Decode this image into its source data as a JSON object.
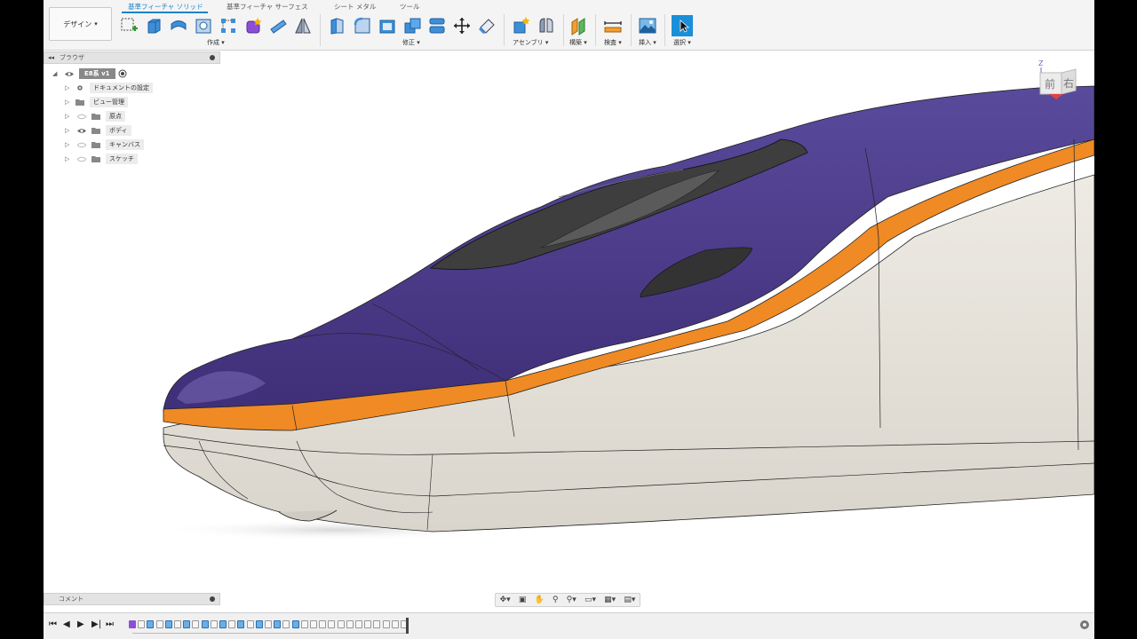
{
  "workspace": {
    "label": "デザイン",
    "caret": "▾"
  },
  "tabs": [
    {
      "label": "基準フィーチャ ソリッド",
      "active": true
    },
    {
      "label": "基準フィーチャ サーフェス",
      "active": false
    },
    {
      "label": "シート メタル",
      "active": false
    },
    {
      "label": "ツール",
      "active": false
    }
  ],
  "toolbar_groups": [
    {
      "label": "作成 ▾",
      "icons": [
        "new-sketch-icon",
        "extrude-icon",
        "revolve-icon",
        "hole-icon",
        "rectangular-pattern-icon",
        "create-form-icon",
        "pipe-icon",
        "mirror-icon"
      ]
    },
    {
      "label": "修正 ▾",
      "icons": [
        "press-pull-icon",
        "fillet-icon",
        "shell-icon",
        "combine-icon",
        "split-body-icon",
        "move-icon",
        "appearance-icon"
      ]
    },
    {
      "label": "アセンブリ ▾",
      "icons": [
        "new-component-icon",
        "joint-icon"
      ]
    },
    {
      "label": "構築 ▾",
      "icons": [
        "offset-plane-icon"
      ]
    },
    {
      "label": "検査 ▾",
      "icons": [
        "measure-icon"
      ]
    },
    {
      "label": "挿入 ▾",
      "icons": [
        "insert-image-icon"
      ]
    },
    {
      "label": "選択 ▾",
      "icons": [
        "select-cursor-icon"
      ]
    }
  ],
  "browser": {
    "title": "ブラウザ",
    "arrows": "◂◂",
    "root": {
      "label": "E8系 v1"
    },
    "items": [
      {
        "label": "ドキュメントの設定",
        "icon": "gear-icon",
        "visible": null
      },
      {
        "label": "ビュー管理",
        "icon": "folder-icon",
        "visible": null
      },
      {
        "label": "原点",
        "icon": "folder-icon",
        "visible": false
      },
      {
        "label": "ボディ",
        "icon": "folder-icon",
        "visible": true
      },
      {
        "label": "キャンバス",
        "icon": "folder-icon",
        "visible": false
      },
      {
        "label": "スケッチ",
        "icon": "folder-icon",
        "visible": false
      }
    ]
  },
  "comments": {
    "title": "コメント"
  },
  "viewcube": {
    "front": "前",
    "right": "右",
    "axis": "Z"
  },
  "colors": {
    "accent": "#1a83c9",
    "body_purple": "#4a3a86",
    "stripe_orange": "#f08a24",
    "body_white": "#e6e2da",
    "window_dark": "#3a3a3a"
  },
  "navbar": {
    "icons": [
      "orbit-icon",
      "look-at-icon",
      "pan-icon",
      "zoom-icon",
      "fit-icon",
      "display-settings-icon",
      "grid-icon",
      "viewports-icon"
    ]
  },
  "timeline": {
    "controls": [
      "⏮",
      "◀",
      "▶",
      "▶|",
      "⏭"
    ],
    "features": [
      "form",
      "sketch",
      "form",
      "sketch",
      "form",
      "sketch",
      "form",
      "sketch",
      "form",
      "sketch",
      "form",
      "sketch",
      "form",
      "sketch",
      "form",
      "sketch",
      "form",
      "sketch",
      "form",
      "sketch",
      "sketch",
      "sketch",
      "sketch",
      "sketch",
      "sketch",
      "sketch",
      "sketch",
      "sketch",
      "sketch",
      "sketch",
      "sketch"
    ]
  }
}
